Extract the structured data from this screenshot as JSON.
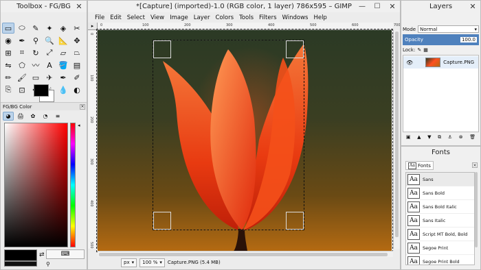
{
  "toolbox": {
    "title": "Toolbox - FG/BG",
    "close": "✕",
    "tools": [
      {
        "name": "rect-select-icon",
        "glyph": "▭",
        "selected": true
      },
      {
        "name": "ellipse-select-icon",
        "glyph": "⬭",
        "selected": false
      },
      {
        "name": "free-select-icon",
        "glyph": "✎",
        "selected": false
      },
      {
        "name": "fuzzy-select-icon",
        "glyph": "✦",
        "selected": false
      },
      {
        "name": "color-select-icon",
        "glyph": "◈",
        "selected": false
      },
      {
        "name": "scissors-select-icon",
        "glyph": "✂",
        "selected": false
      },
      {
        "name": "foreground-select-icon",
        "glyph": "◉",
        "selected": false
      },
      {
        "name": "paths-icon",
        "glyph": "✒",
        "selected": false
      },
      {
        "name": "color-picker-icon",
        "glyph": "⚲",
        "selected": false
      },
      {
        "name": "zoom-icon",
        "glyph": "🔍",
        "selected": false
      },
      {
        "name": "measure-icon",
        "glyph": "📐",
        "selected": false
      },
      {
        "name": "move-icon",
        "glyph": "✥",
        "selected": false
      },
      {
        "name": "align-icon",
        "glyph": "⊞",
        "selected": false
      },
      {
        "name": "crop-icon",
        "glyph": "⌗",
        "selected": false
      },
      {
        "name": "rotate-icon",
        "glyph": "↻",
        "selected": false
      },
      {
        "name": "scale-icon",
        "glyph": "⤢",
        "selected": false
      },
      {
        "name": "shear-icon",
        "glyph": "▱",
        "selected": false
      },
      {
        "name": "perspective-icon",
        "glyph": "⏢",
        "selected": false
      },
      {
        "name": "flip-icon",
        "glyph": "⇋",
        "selected": false
      },
      {
        "name": "cage-icon",
        "glyph": "⬠",
        "selected": false
      },
      {
        "name": "warp-icon",
        "glyph": "〰",
        "selected": false
      },
      {
        "name": "text-icon",
        "glyph": "A",
        "selected": false
      },
      {
        "name": "bucket-fill-icon",
        "glyph": "🪣",
        "selected": false
      },
      {
        "name": "blend-icon",
        "glyph": "▤",
        "selected": false
      },
      {
        "name": "pencil-icon",
        "glyph": "✏",
        "selected": false
      },
      {
        "name": "paintbrush-icon",
        "glyph": "🖌",
        "selected": false
      },
      {
        "name": "eraser-icon",
        "glyph": "▭",
        "selected": false
      },
      {
        "name": "airbrush-icon",
        "glyph": "✈",
        "selected": false
      },
      {
        "name": "ink-icon",
        "glyph": "✒",
        "selected": false
      },
      {
        "name": "mypaint-brush-icon",
        "glyph": "✐",
        "selected": false
      },
      {
        "name": "clone-icon",
        "glyph": "⎘",
        "selected": false
      },
      {
        "name": "perspective-clone-icon",
        "glyph": "⊡",
        "selected": false
      },
      {
        "name": "heal-icon",
        "glyph": "✚",
        "selected": false
      },
      {
        "name": "smudge-icon",
        "glyph": "☝",
        "selected": false
      },
      {
        "name": "blur-icon",
        "glyph": "💧",
        "selected": false
      },
      {
        "name": "dodge-burn-icon",
        "glyph": "◐",
        "selected": false
      }
    ],
    "fgbg_tab": "FG/BG Color",
    "tab_close": "×",
    "color_modes": [
      {
        "name": "gimp-mode-icon",
        "glyph": "◕",
        "selected": true
      },
      {
        "name": "cmyk-mode-icon",
        "glyph": "🖨",
        "selected": false
      },
      {
        "name": "watercolor-mode-icon",
        "glyph": "✿",
        "selected": false
      },
      {
        "name": "wheel-mode-icon",
        "glyph": "◔",
        "selected": false
      },
      {
        "name": "scales-mode-icon",
        "glyph": "≡",
        "selected": false
      }
    ],
    "hue_arrow": "◂",
    "swap_glyph": "⇄",
    "hex_glyph": "⌨",
    "picker_glyph": "⚲"
  },
  "image_window": {
    "title": "*[Capture] (imported)-1.0 (RGB color, 1 layer) 786x595 – GIMP",
    "min": "—",
    "max": "☐",
    "close": "✕",
    "menu": [
      "File",
      "Edit",
      "Select",
      "View",
      "Image",
      "Layer",
      "Colors",
      "Tools",
      "Filters",
      "Windows",
      "Help"
    ],
    "ruler_h": [
      "0",
      "100",
      "200",
      "300",
      "400",
      "500",
      "600",
      "700"
    ],
    "ruler_v": [
      "0",
      "100",
      "200",
      "300",
      "400",
      "500"
    ],
    "corner": "▸",
    "unit": "px",
    "zoom": "100 %",
    "status": "Capture.PNG (5.4 MB)",
    "selection_frame_color": "#ffffff"
  },
  "layers": {
    "title": "Layers",
    "close": "✕",
    "mode_label": "Mode",
    "mode_value": "Normal",
    "opacity_label": "Opacity",
    "opacity_value": "100.0",
    "lock_label": "Lock:",
    "layer_name": "Capture.PNG",
    "eye": "👁",
    "tools": [
      "▣",
      "▲",
      "▼",
      "⧉",
      "⚓",
      "⊗",
      "🗑"
    ]
  },
  "fonts": {
    "title": "Fonts",
    "tab_label": "Fonts",
    "tab_icon": "Aa",
    "tab_close": "×",
    "items": [
      {
        "preview": "Aa",
        "label": "Sans",
        "selected": true
      },
      {
        "preview": "Aa",
        "label": "Sans Bold",
        "selected": false
      },
      {
        "preview": "Aa",
        "label": "Sans Bold Italic",
        "selected": false
      },
      {
        "preview": "Aa",
        "label": "Sans Italic",
        "selected": false
      },
      {
        "preview": "Aa",
        "label": "Script MT Bold, Bold",
        "selected": false
      },
      {
        "preview": "Aa",
        "label": "Segoe Print",
        "selected": false
      },
      {
        "preview": "Aa",
        "label": "Segoe Print Bold",
        "selected": false
      }
    ]
  }
}
